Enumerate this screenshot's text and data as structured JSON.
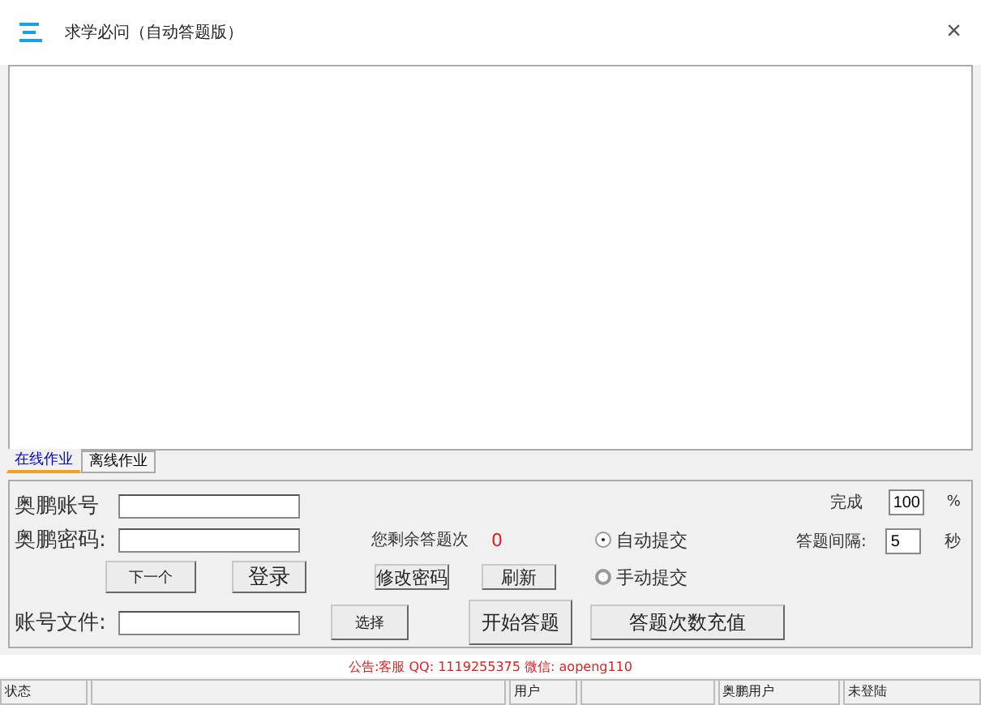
{
  "window": {
    "title": "求学必问（自动答题版）",
    "close": "×"
  },
  "tabs": [
    {
      "label": "在线作业",
      "selected": true
    },
    {
      "label": "离线作业",
      "selected": false
    }
  ],
  "login": {
    "account_label": "奥鹏账号",
    "password_label": "奥鹏密码:",
    "next_button": "下一个",
    "login_button": "登录",
    "file_label": "账号文件:",
    "choose_button": "选择"
  },
  "remaining": {
    "label": "您剩余答题次",
    "value": "0"
  },
  "buttons": {
    "change_password": "修改密码",
    "refresh": "刷新",
    "start": "开始答题",
    "recharge": "答题次数充值"
  },
  "submit_modes": [
    {
      "label": "自动提交",
      "selected": true
    },
    {
      "label": "手动提交",
      "selected": false
    }
  ],
  "progress": {
    "label": "完成",
    "value": "100",
    "unit": "%"
  },
  "interval": {
    "label": "答题间隔:",
    "value": "5",
    "unit": "秒"
  },
  "notice": "公告:客服 QQ: 1119255375 微信: aopeng110",
  "status_bar": [
    {
      "kind": "text",
      "label": "状态"
    },
    {
      "kind": "blank"
    },
    {
      "kind": "text",
      "label": "用户"
    },
    {
      "kind": "blank"
    },
    {
      "kind": "text",
      "label": "奥鹏用户"
    },
    {
      "kind": "text",
      "label": "未登陆"
    }
  ]
}
